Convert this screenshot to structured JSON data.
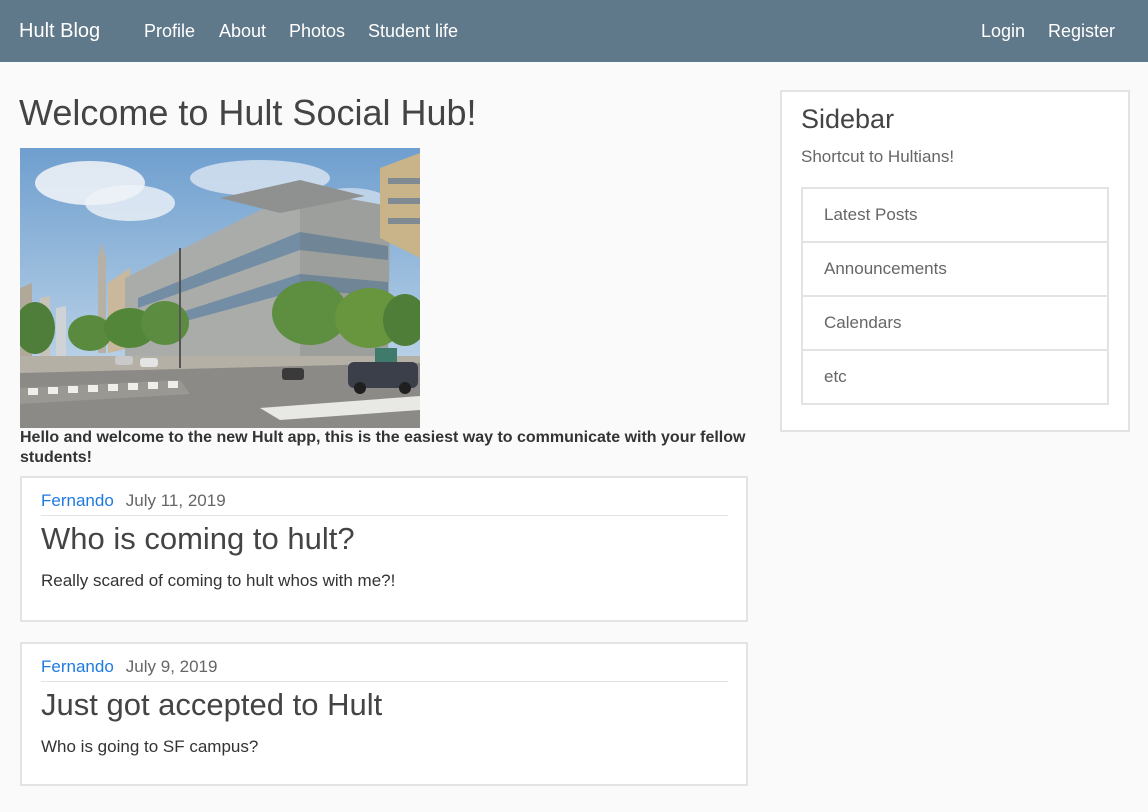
{
  "navbar": {
    "brand": "Hult Blog",
    "links": [
      "Profile",
      "About",
      "Photos",
      "Student life"
    ],
    "auth": [
      "Login",
      "Register"
    ],
    "background_color": "#5f788a"
  },
  "main": {
    "title": "Welcome to Hult Social Hub!",
    "hero_image_icon": "campus-building-photo",
    "welcome_text": "Hello and welcome to the new Hult app, this is the easiest way to communicate with your fellow students!",
    "posts": [
      {
        "author": "Fernando",
        "date": "July 11, 2019",
        "title": "Who is coming to hult?",
        "body": "Really scared of coming to hult whos with me?!"
      },
      {
        "author": "Fernando",
        "date": "July 9, 2019",
        "title": "Just got accepted to Hult",
        "body": "Who is going to SF campus?"
      }
    ]
  },
  "sidebar": {
    "title": "Sidebar",
    "subtitle": "Shortcut to Hultians!",
    "items": [
      "Latest Posts",
      "Announcements",
      "Calendars",
      "etc"
    ]
  },
  "colors": {
    "link": "#1f7ae0",
    "border": "#e3e3e3"
  }
}
